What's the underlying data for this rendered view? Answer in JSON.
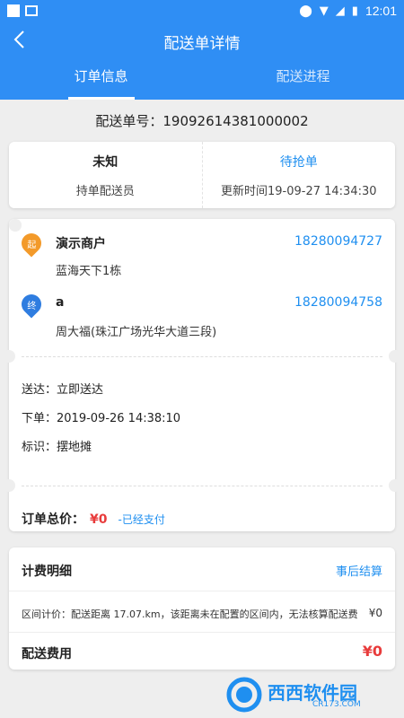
{
  "status_bar": {
    "time": "12:01"
  },
  "header": {
    "title": "配送单详情",
    "back_icon": "chevron-left-icon"
  },
  "tabs": [
    {
      "label": "订单信息",
      "active": true
    },
    {
      "label": "配送进程",
      "active": false
    }
  ],
  "order": {
    "number_label": "配送单号：19092614381000002"
  },
  "status": {
    "courier_name": "未知",
    "courier_label": "持单配送员",
    "state": "待抢单",
    "updated": "更新时间19-09-27 14:34:30"
  },
  "pickup": {
    "pin": "起",
    "name": "演示商户",
    "phone": "18280094727",
    "address": "蓝海天下1栋"
  },
  "dropoff": {
    "pin": "终",
    "name": "a",
    "phone": "18280094758",
    "address": "周大福(珠江广场光华大道三段)"
  },
  "details": {
    "delivery": "送达：立即送达",
    "ordered": "下单：2019-09-26 14:38:10",
    "tag": "标识：摆地摊"
  },
  "total": {
    "label": "订单总价：",
    "amount": "¥0",
    "paid": "-已经支付"
  },
  "fees": {
    "title": "计费明细",
    "settle": "事后结算",
    "range_note": "区间计价：配送距离 17.07.km，该距离未在配置的区间内，无法核算配送费",
    "range_value": "¥0",
    "delivery_fee_label": "配送费用",
    "delivery_fee_value": "¥0"
  },
  "watermark": {
    "brand": "西西软件园",
    "site": "CR173.COM"
  },
  "colors": {
    "primary": "#2f8ef4",
    "link": "#1f8ff0",
    "price": "#e83b3b",
    "pin_start": "#f39a2a",
    "pin_end": "#2f7de0"
  }
}
